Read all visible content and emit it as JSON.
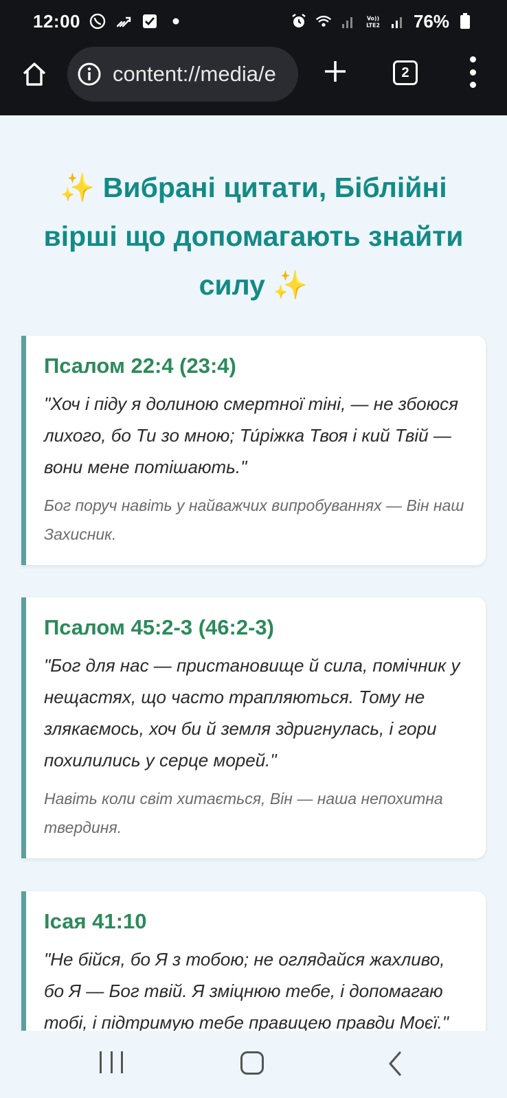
{
  "status_bar": {
    "time": "12:00",
    "battery": "76%",
    "icons_left": [
      "viber-icon",
      "missed-call-icon",
      "checkbox-icon",
      "dot-icon"
    ],
    "icons_right": [
      "alarm-icon",
      "wifi-icon",
      "volte-lte2-icon",
      "signal-icon",
      "battery-icon"
    ]
  },
  "browser": {
    "url": "content://media/e",
    "tab_count": "2"
  },
  "page": {
    "title": "✨ Вибрані цитати, Біблійні вірші що допомагають знайти силу ✨",
    "cards": [
      {
        "reference": "Псалом 22:4 (23:4)",
        "quote": "\"Хоч і піду я долиною смертної тіні, — не збоюся лихого, бо Ти зо мною; Ти́ріжка Твоя і кий Твій — вони мене потішають.\"",
        "note": "Бог поруч навіть у найважчих випробуваннях — Він наш Захисник."
      },
      {
        "reference": "Псалом 45:2-3 (46:2-3)",
        "quote": "\"Бог для нас — пристановище й сила, помічник у нещастях, що часто трапляються. Тому не злякаємось, хоч би й земля здригнулась, і гори похилились у серце морей.\"",
        "note": "Навіть коли світ хитається, Він — наша непохитна твердиня."
      },
      {
        "reference": "Ісая 41:10",
        "quote": "\"Не бійся, бо Я з тобою; не оглядайся жахливо, бо Я — Бог твій. Я зміцнюю тебе, і допомагаю тобі, і підтримую тебе правицею правди Моєї.\"",
        "note": ""
      }
    ]
  },
  "colors": {
    "title": "#138a86",
    "reference": "#2b8a5a",
    "card_border": "#5e9e9b",
    "background": "#eef6fb",
    "system_bar": "#131418"
  }
}
